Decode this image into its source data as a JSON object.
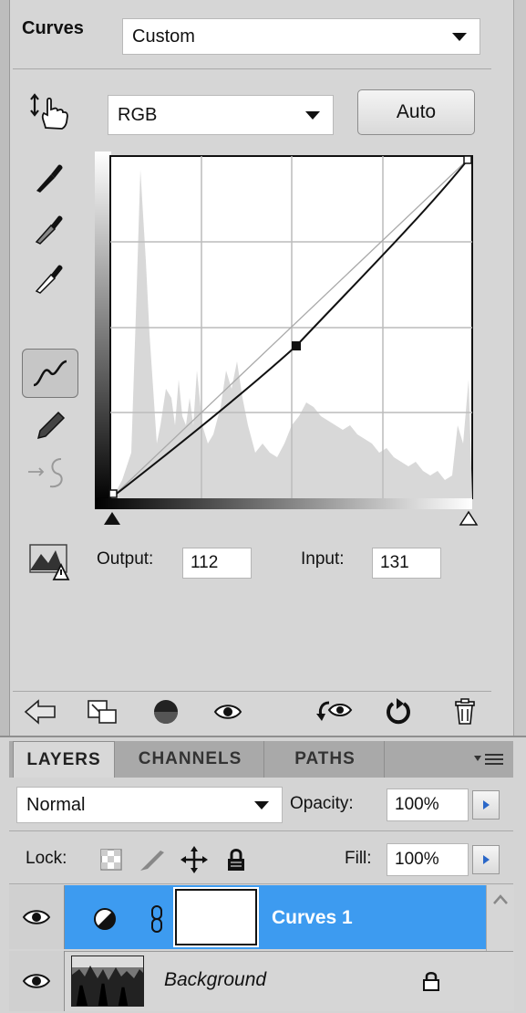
{
  "adjustments": {
    "panel_title": "Curves",
    "preset_value": "Custom",
    "channel_value": "RGB",
    "auto_label": "Auto",
    "output_label": "Output:",
    "output_value": "112",
    "input_label": "Input:",
    "input_value": "131"
  },
  "layers_panel": {
    "tabs": [
      {
        "label": "LAYERS",
        "active": true
      },
      {
        "label": "CHANNELS",
        "active": false
      },
      {
        "label": "PATHS",
        "active": false
      }
    ],
    "blend_mode": "Normal",
    "opacity_label": "Opacity:",
    "opacity_value": "100%",
    "lock_label": "Lock:",
    "fill_label": "Fill:",
    "fill_value": "100%",
    "layers": [
      {
        "name": "Curves 1",
        "selected": true
      },
      {
        "name": "Background",
        "selected": false
      }
    ]
  },
  "colors": {
    "selection": "#3d9bf0",
    "panel": "#d6d6d6"
  }
}
